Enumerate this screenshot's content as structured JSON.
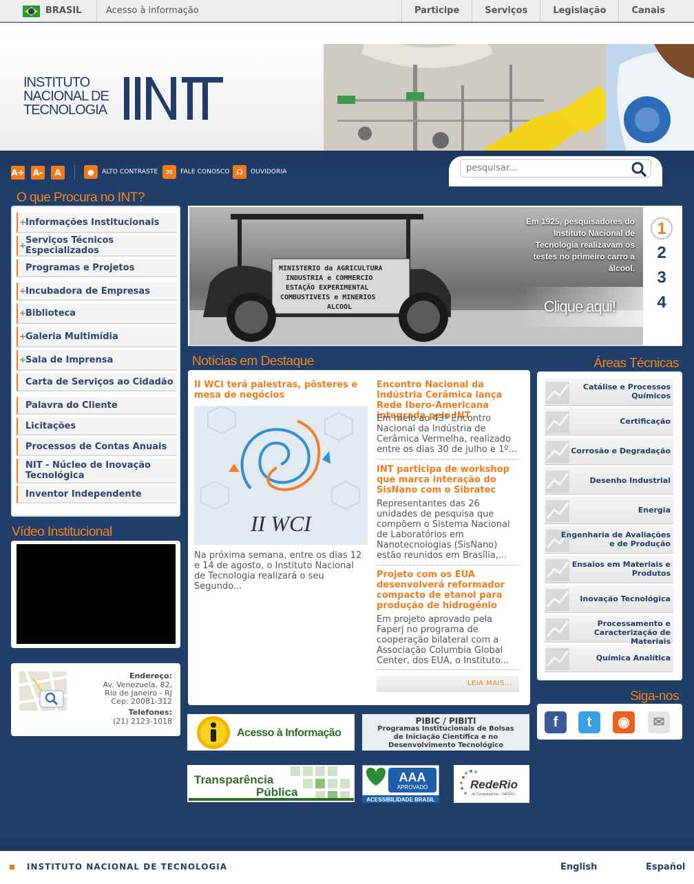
{
  "gov_bar": {
    "country": "BRASIL",
    "access": "Acesso à informação",
    "nav": [
      "Participe",
      "Serviços",
      "Legislação",
      "Canais"
    ]
  },
  "header": {
    "logo_lines": [
      "INSTITUTO",
      "NACIONAL DE",
      "TECNOLOGIA"
    ]
  },
  "toolbar": {
    "font_buttons": [
      "A+",
      "A-",
      "A"
    ],
    "contrast": "ALTO CONTRASTE",
    "contact": "FALE CONOSCO",
    "ombudsman": "OUVIDORIA"
  },
  "search": {
    "placeholder": "pesquisar..."
  },
  "left_menu": {
    "title": "O que Procura no INT?",
    "items": [
      {
        "label": "Informações Institucionais",
        "expandable": true
      },
      {
        "label": "Serviços Técnicos Especializados",
        "expandable": true
      },
      {
        "label": "Programas e Projetos",
        "expandable": false
      },
      {
        "label": "Incubadora de Empresas",
        "expandable": true
      },
      {
        "label": "Biblioteca",
        "expandable": true
      },
      {
        "label": "Galeria Multimídia",
        "expandable": true
      },
      {
        "label": "Sala de Imprensa",
        "expandable": true
      },
      {
        "label": "Carta de Serviços ao Cidadão",
        "expandable": false
      },
      {
        "label": "Palavra do Cliente",
        "expandable": false
      },
      {
        "label": "Licitações",
        "expandable": false
      },
      {
        "label": "Processos de Contas Anuais",
        "expandable": false
      },
      {
        "label": "NIT - Núcleo de Inovação Tecnológica",
        "expandable": false
      },
      {
        "label": "Inventor Independente",
        "expandable": false
      }
    ]
  },
  "video": {
    "title": "Vídeo Institucional"
  },
  "address": {
    "label": "Endereço:",
    "lines": [
      "Av. Venezuela, 82,",
      "Rio de Janeiro - RJ",
      "Cep: 20081-312"
    ],
    "phone_label": "Telefones:",
    "phone": "(21) 2123-1018"
  },
  "slider": {
    "caption": "Em 1925, pesquisadores do Instituto Nacional de Tecnologia realizavam os testes no primeiro carro a álcool.",
    "cta": "Clique aqui!",
    "pages": [
      "1",
      "2",
      "3",
      "4"
    ],
    "active_page": 1,
    "car_sign": [
      "MINISTERIO da AGRICULTURA",
      "INDUSTRIA e COMMERCIO",
      "ESTAÇÃO EXPERIMENTAL",
      "COMBUSTIVEIS e MINERIOS",
      "ALCOOL"
    ]
  },
  "news": {
    "title": "Notícias em Destaque",
    "feature": {
      "headline": "II WCI terá palestras, pôsteres e mesa de negócios",
      "image_text": "II WCI",
      "summary": "Na próxima semana, entre os dias 12 e 14 de agosto, o Instituto Nacional de Tecnologia realizará o seu Segundo..."
    },
    "items": [
      {
        "headline": "Encontro Nacional da Indústria Cerâmica lança Rede Ibero-Americana integrada pelo INT",
        "summary": "Em meio ao 43º Encontro Nacional da Indústria de Cerâmica Vermelha, realizado entre os dias 30 de julho e 1º..."
      },
      {
        "headline": "INT participa de workshop que marca interação do SisNano com o Sibratec",
        "summary": "Representantes das 26 unidades de pesquisa que compõem o Sistema Nacional de Laboratórios em Nanotecnologias (SisNano) estão reunidos em Brasília,..."
      },
      {
        "headline": "Projeto com os EUA desenvolverá reformador compacto de etanol para produção de hidrogênio",
        "summary": "Em projeto aprovado pela Faperj no programa de cooperação bilateral com a Associação Columbia Global Center, dos EUA, o Instituto..."
      }
    ],
    "more": "LEIA MAIS..."
  },
  "areas": {
    "title": "Áreas Técnicas",
    "items": [
      "Catálise e Processos Químicos",
      "Certificação",
      "Corrosão e Degradação",
      "Desenho Industrial",
      "Energia",
      "Engenharia de Avaliações e de Produção",
      "Ensaios em Materiais e Produtos",
      "Inovação Tecnológica",
      "Processamento e Caracterização de Materiais",
      "Química Analítica"
    ]
  },
  "social": {
    "title": "Siga-nos",
    "items": [
      {
        "name": "facebook-icon",
        "glyph": "f",
        "color": "#3b5998"
      },
      {
        "name": "twitter-icon",
        "glyph": "t",
        "color": "#3aa0e0"
      },
      {
        "name": "rss-icon",
        "glyph": "◉",
        "color": "#e8621e"
      },
      {
        "name": "email-icon",
        "glyph": "✉",
        "color": "#cfcfcf"
      }
    ]
  },
  "banners": {
    "acesso": "Acesso à Informação",
    "pibic_title": "PIBIC / PIBITI",
    "pibic_sub": [
      "Programas Institucionais de Bolsas",
      "de Iniciação Científica e no",
      "Desenvolvimento Tecnológico"
    ],
    "transparencia": [
      "Transparência",
      "Pública"
    ],
    "aaa": "AAA",
    "aaa_sub": "APROVADO",
    "aaa_band": "ACESSIBILIDADE BRASIL",
    "rederio": "RedeRio",
    "rederio_sub": "de Computadores - FAPERJ"
  },
  "footer": {
    "name": "INSTITUTO NACIONAL DE TECNOLOGIA",
    "languages": [
      "English",
      "Español"
    ]
  },
  "colors": {
    "navy": "#213f6b",
    "orange": "#f07c1f",
    "title_orange": "#f58b28"
  }
}
